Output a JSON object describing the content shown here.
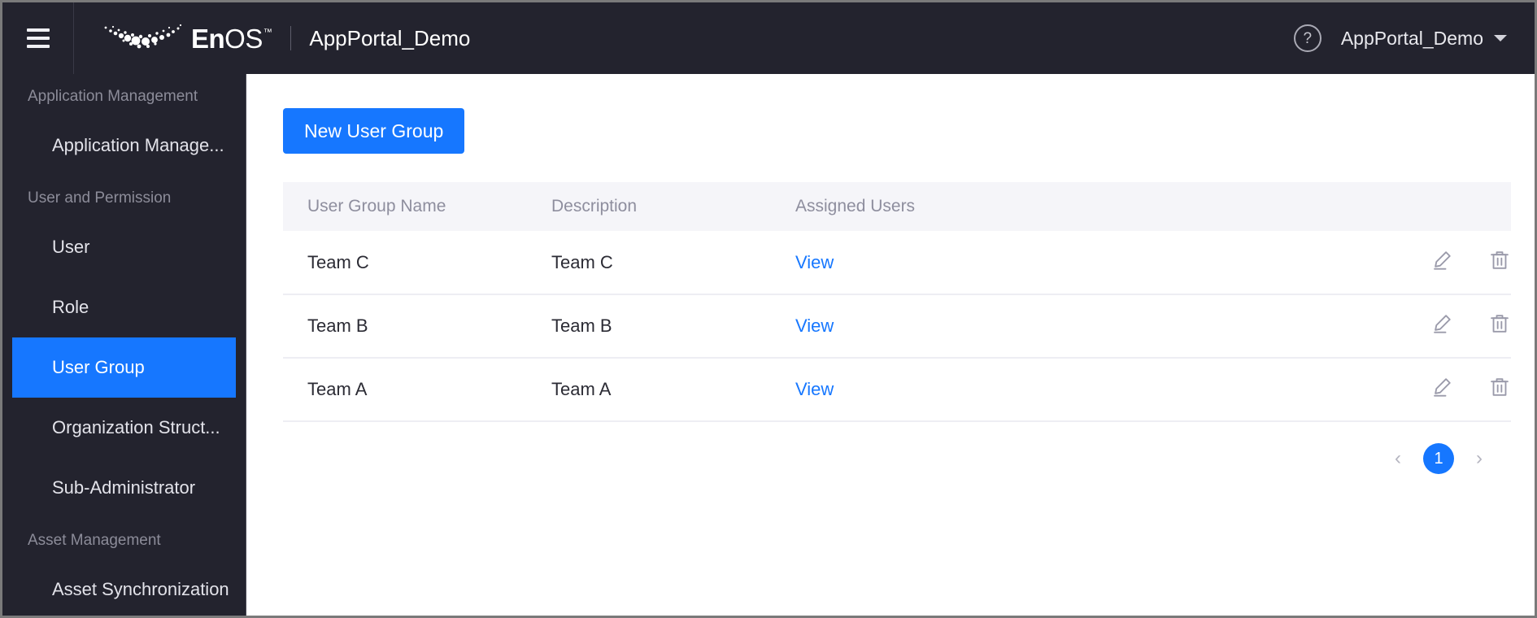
{
  "header": {
    "menu_icon": "hamburger-icon",
    "brand_logo_icon": "enos-crescent-logo-icon",
    "brand_en": "En",
    "brand_os": "OS",
    "brand_tm": "™",
    "portal_title": "AppPortal_Demo",
    "help_icon": "question-mark-icon",
    "user_menu_label": "AppPortal_Demo",
    "user_menu_caret_icon": "chevron-down-icon"
  },
  "sidebar": {
    "groups": [
      {
        "title": "Application Management",
        "items": [
          {
            "label": "Application Manage...",
            "active": false
          }
        ]
      },
      {
        "title": "User and Permission",
        "items": [
          {
            "label": "User",
            "active": false
          },
          {
            "label": "Role",
            "active": false
          },
          {
            "label": "User Group",
            "active": true
          },
          {
            "label": "Organization Struct...",
            "active": false
          },
          {
            "label": "Sub-Administrator",
            "active": false
          }
        ]
      },
      {
        "title": "Asset Management",
        "items": [
          {
            "label": "Asset Synchronization",
            "active": false
          }
        ]
      }
    ]
  },
  "main": {
    "new_user_group_label": "New User Group",
    "table": {
      "columns": [
        "User Group Name",
        "Description",
        "Assigned Users",
        ""
      ],
      "rows": [
        {
          "name": "Team C",
          "description": "Team C",
          "assigned_users_link": "View",
          "edit_icon": "pencil-edit-icon",
          "delete_icon": "trash-delete-icon"
        },
        {
          "name": "Team B",
          "description": "Team B",
          "assigned_users_link": "View",
          "edit_icon": "pencil-edit-icon",
          "delete_icon": "trash-delete-icon"
        },
        {
          "name": "Team A",
          "description": "Team A",
          "assigned_users_link": "View",
          "edit_icon": "pencil-edit-icon",
          "delete_icon": "trash-delete-icon"
        }
      ]
    },
    "pagination": {
      "prev_icon": "chevron-left-icon",
      "next_icon": "chevron-right-icon",
      "current_page": "1"
    }
  },
  "colors": {
    "accent_blue": "#1677ff",
    "header_dark": "#23232e",
    "table_header_bg": "#f5f5f9",
    "link_blue": "#1677ff"
  }
}
